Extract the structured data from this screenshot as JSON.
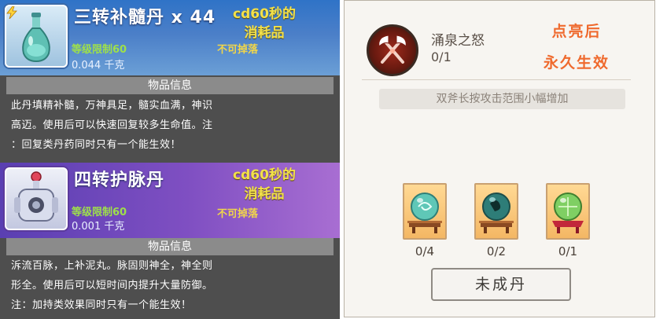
{
  "left_panel": {
    "items": [
      {
        "name": "三转补髓丹 x 44",
        "note_line1": "cd60秒的",
        "note_line2": "消耗品",
        "level_limit": "等级限制60",
        "no_drop": "不可掉落",
        "weight": "0.044 千克",
        "section_title": "物品信息",
        "desc_lines": [
          "此丹填精补髓，万神具足，髓实血满，神识",
          "高迈。使用后可以快速回复较多生命值。注",
          "：回复类丹药同时只有一个能生效！"
        ]
      },
      {
        "name": "四转护脉丹",
        "note_line1": "cd60秒的",
        "note_line2": "消耗品",
        "level_limit": "等级限制60",
        "no_drop": "不可掉落",
        "weight": "0.001 千克",
        "section_title": "物品信息",
        "desc_lines": [
          "泝流百脉，上补泥丸。脉固则神全，神全则",
          "形全。使用后可以短时间内提升大量防御。",
          "注：加持类效果同时只有一个能生效！"
        ]
      }
    ]
  },
  "right_panel": {
    "skill_name": "涌泉之怒",
    "skill_count": "0/1",
    "note_line1": "点亮后",
    "note_line2": "永久生效",
    "effect_desc": "双斧长按攻击范围小幅增加",
    "ingredients": [
      {
        "icon": "jade-orb-icon",
        "count": "0/4"
      },
      {
        "icon": "dark-orb-icon",
        "count": "0/2"
      },
      {
        "icon": "green-orb-red-stand-icon",
        "count": "0/1"
      }
    ],
    "button_label": "未成丹"
  },
  "colors": {
    "card1_header": "#2f73c7",
    "card2_header": "#7f4fc2",
    "note_yellow": "#f2e04a",
    "level_green": "#9ee04a",
    "red_note": "#ef6a2e"
  }
}
